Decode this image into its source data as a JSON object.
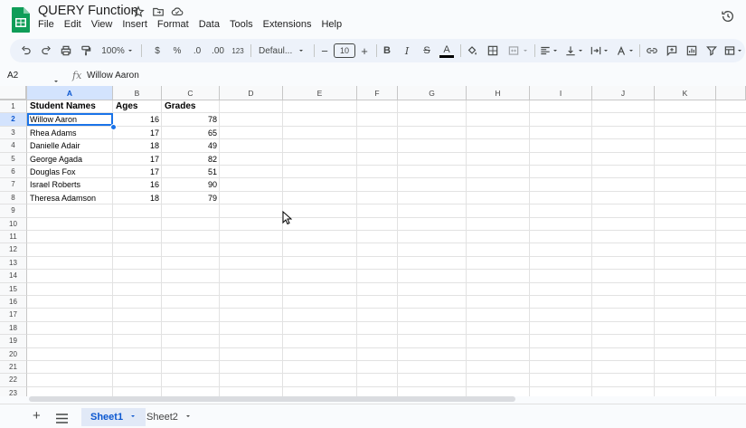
{
  "app": {
    "doc_title": "QUERY Function",
    "menus": [
      "File",
      "Edit",
      "View",
      "Insert",
      "Format",
      "Data",
      "Tools",
      "Extensions",
      "Help"
    ]
  },
  "toolbar": {
    "zoom": "100%",
    "currency": "$",
    "percent": "%",
    "decrease_decimal": ".0",
    "increase_decimal": ".00",
    "number_format": "123",
    "font_family": "Defaul...",
    "font_size": "10",
    "bold": "B",
    "italic": "I",
    "strike": "S",
    "text_color": "A"
  },
  "formula_bar": {
    "name_box": "A2",
    "fx": "fx",
    "content": "Willow Aaron"
  },
  "grid": {
    "columns": [
      "A",
      "B",
      "C",
      "D",
      "E",
      "F",
      "G",
      "H",
      "I",
      "J",
      "K"
    ],
    "rows": [
      "1",
      "2",
      "3",
      "4",
      "5",
      "6",
      "7",
      "8",
      "9",
      "10",
      "11",
      "12",
      "13",
      "14",
      "15",
      "16",
      "17",
      "18",
      "19",
      "20",
      "21",
      "22",
      "23"
    ],
    "headers": [
      "Student Names",
      "Ages",
      "Grades"
    ],
    "data": [
      [
        "Willow Aaron",
        "16",
        "78"
      ],
      [
        "Rhea Adams",
        "17",
        "65"
      ],
      [
        "Danielle Adair",
        "18",
        "49"
      ],
      [
        "George Agada",
        "17",
        "82"
      ],
      [
        "Douglas Fox",
        "17",
        "51"
      ],
      [
        "Israel Roberts",
        "16",
        "90"
      ],
      [
        "Theresa Adamson",
        "18",
        "79"
      ]
    ],
    "selected_cell": "A2"
  },
  "sheets": {
    "add": "+",
    "tabs": [
      "Sheet1",
      "Sheet2"
    ],
    "active": "Sheet1"
  },
  "colors": {
    "accent": "#1a73e8",
    "sheets_green": "#0f9d58",
    "toolbar_bg": "#edf2fa"
  }
}
